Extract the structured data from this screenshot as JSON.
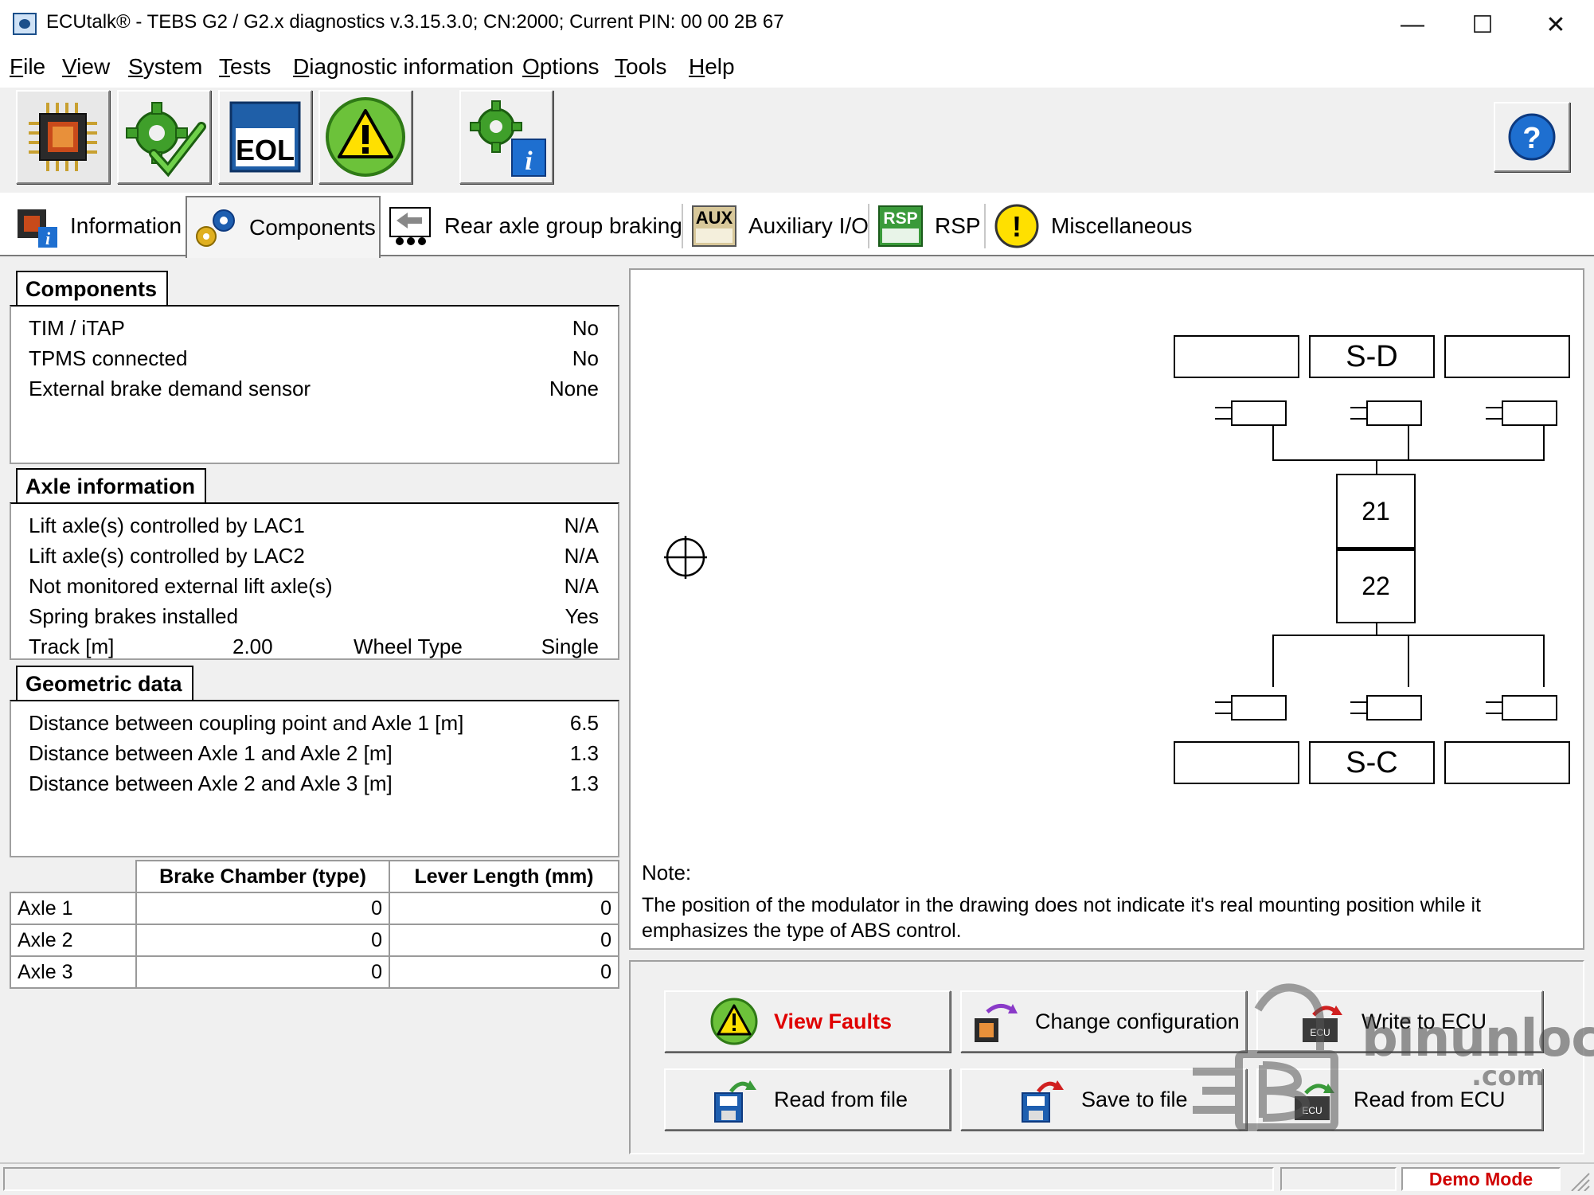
{
  "window": {
    "title": "ECUtalk® - TEBS G2 / G2.x diagnostics v.3.15.3.0; CN:2000; Current PIN: 00 00 2B 67",
    "minimize": "—",
    "maximize": "☐",
    "close": "✕"
  },
  "menu": [
    "File",
    "View",
    "System",
    "Tests",
    "Diagnostic information",
    "Options",
    "Tools",
    "Help"
  ],
  "toolbar": {
    "buttons": [
      {
        "icon": "ecu-chip-icon"
      },
      {
        "icon": "gear-check-icon"
      },
      {
        "icon": "eol-icon",
        "label": "EOL"
      },
      {
        "icon": "warning-icon"
      },
      {
        "icon": "gear-info-icon"
      }
    ],
    "help": "?"
  },
  "tabs": [
    {
      "label": "Information",
      "icon": "chip-info-icon"
    },
    {
      "label": "Components",
      "icon": "gears-icon",
      "active": true
    },
    {
      "label": "Rear axle group braking",
      "icon": "trailer-arrow-icon"
    },
    {
      "label": "Auxiliary I/O",
      "icon": "aux-icon",
      "icon_text": "AUX"
    },
    {
      "label": "RSP",
      "icon": "rsp-icon",
      "icon_text": "RSP"
    },
    {
      "label": "Miscellaneous",
      "icon": "exclamation-icon",
      "icon_text": "!"
    }
  ],
  "components": {
    "title": "Components",
    "rows": [
      {
        "label": "TIM / iTAP",
        "value": "No"
      },
      {
        "label": "TPMS connected",
        "value": "No"
      },
      {
        "label": "External brake demand sensor",
        "value": "None"
      }
    ]
  },
  "axle_info": {
    "title": "Axle information",
    "rows": [
      {
        "label": "Lift axle(s) controlled by LAC1",
        "value": "N/A"
      },
      {
        "label": "Lift axle(s) controlled by LAC2",
        "value": "N/A"
      },
      {
        "label": "Not monitored external lift axle(s)",
        "value": "N/A"
      },
      {
        "label": "Spring brakes installed",
        "value": "Yes"
      }
    ],
    "track_label": "Track [m]",
    "track_value": "2.00",
    "wheel_type_label": "Wheel Type",
    "wheel_type_value": "Single"
  },
  "geometric": {
    "title": "Geometric data",
    "rows": [
      {
        "label": "Distance between coupling point and Axle 1 [m]",
        "value": "6.5"
      },
      {
        "label": "Distance between Axle 1 and Axle 2 [m]",
        "value": "1.3"
      },
      {
        "label": "Distance between Axle 2 and Axle 3 [m]",
        "value": "1.3"
      }
    ]
  },
  "brake_table": {
    "headers": [
      "",
      "Brake Chamber (type)",
      "Lever Length (mm)"
    ],
    "rows": [
      {
        "axle": "Axle 1",
        "chamber": "0",
        "lever": "0"
      },
      {
        "axle": "Axle 2",
        "chamber": "0",
        "lever": "0"
      },
      {
        "axle": "Axle 3",
        "chamber": "0",
        "lever": "0"
      }
    ]
  },
  "diagram": {
    "top_label": "S-D",
    "bottom_label": "S-C",
    "modulator_top": "21",
    "modulator_bottom": "22",
    "note_title": "Note:",
    "note_text": "The position of the modulator in the drawing does not indicate it's real mounting position while it emphasizes the type of ABS control."
  },
  "actions": {
    "view_faults": "View Faults",
    "change_config": "Change configuration",
    "write_ecu": "Write to ECU",
    "read_file": "Read from file",
    "save_file": "Save to file",
    "read_ecu": "Read from ECU"
  },
  "status": {
    "mode": "Demo Mode"
  },
  "watermark": {
    "line1": "binunlock",
    "line2": ".com"
  },
  "colors": {
    "view_faults_text": "#e00000",
    "demo_mode_text": "#d00000",
    "warning_green": "#4caf1f",
    "warning_yellow": "#ffe000",
    "help_blue": "#1e6fd0"
  }
}
